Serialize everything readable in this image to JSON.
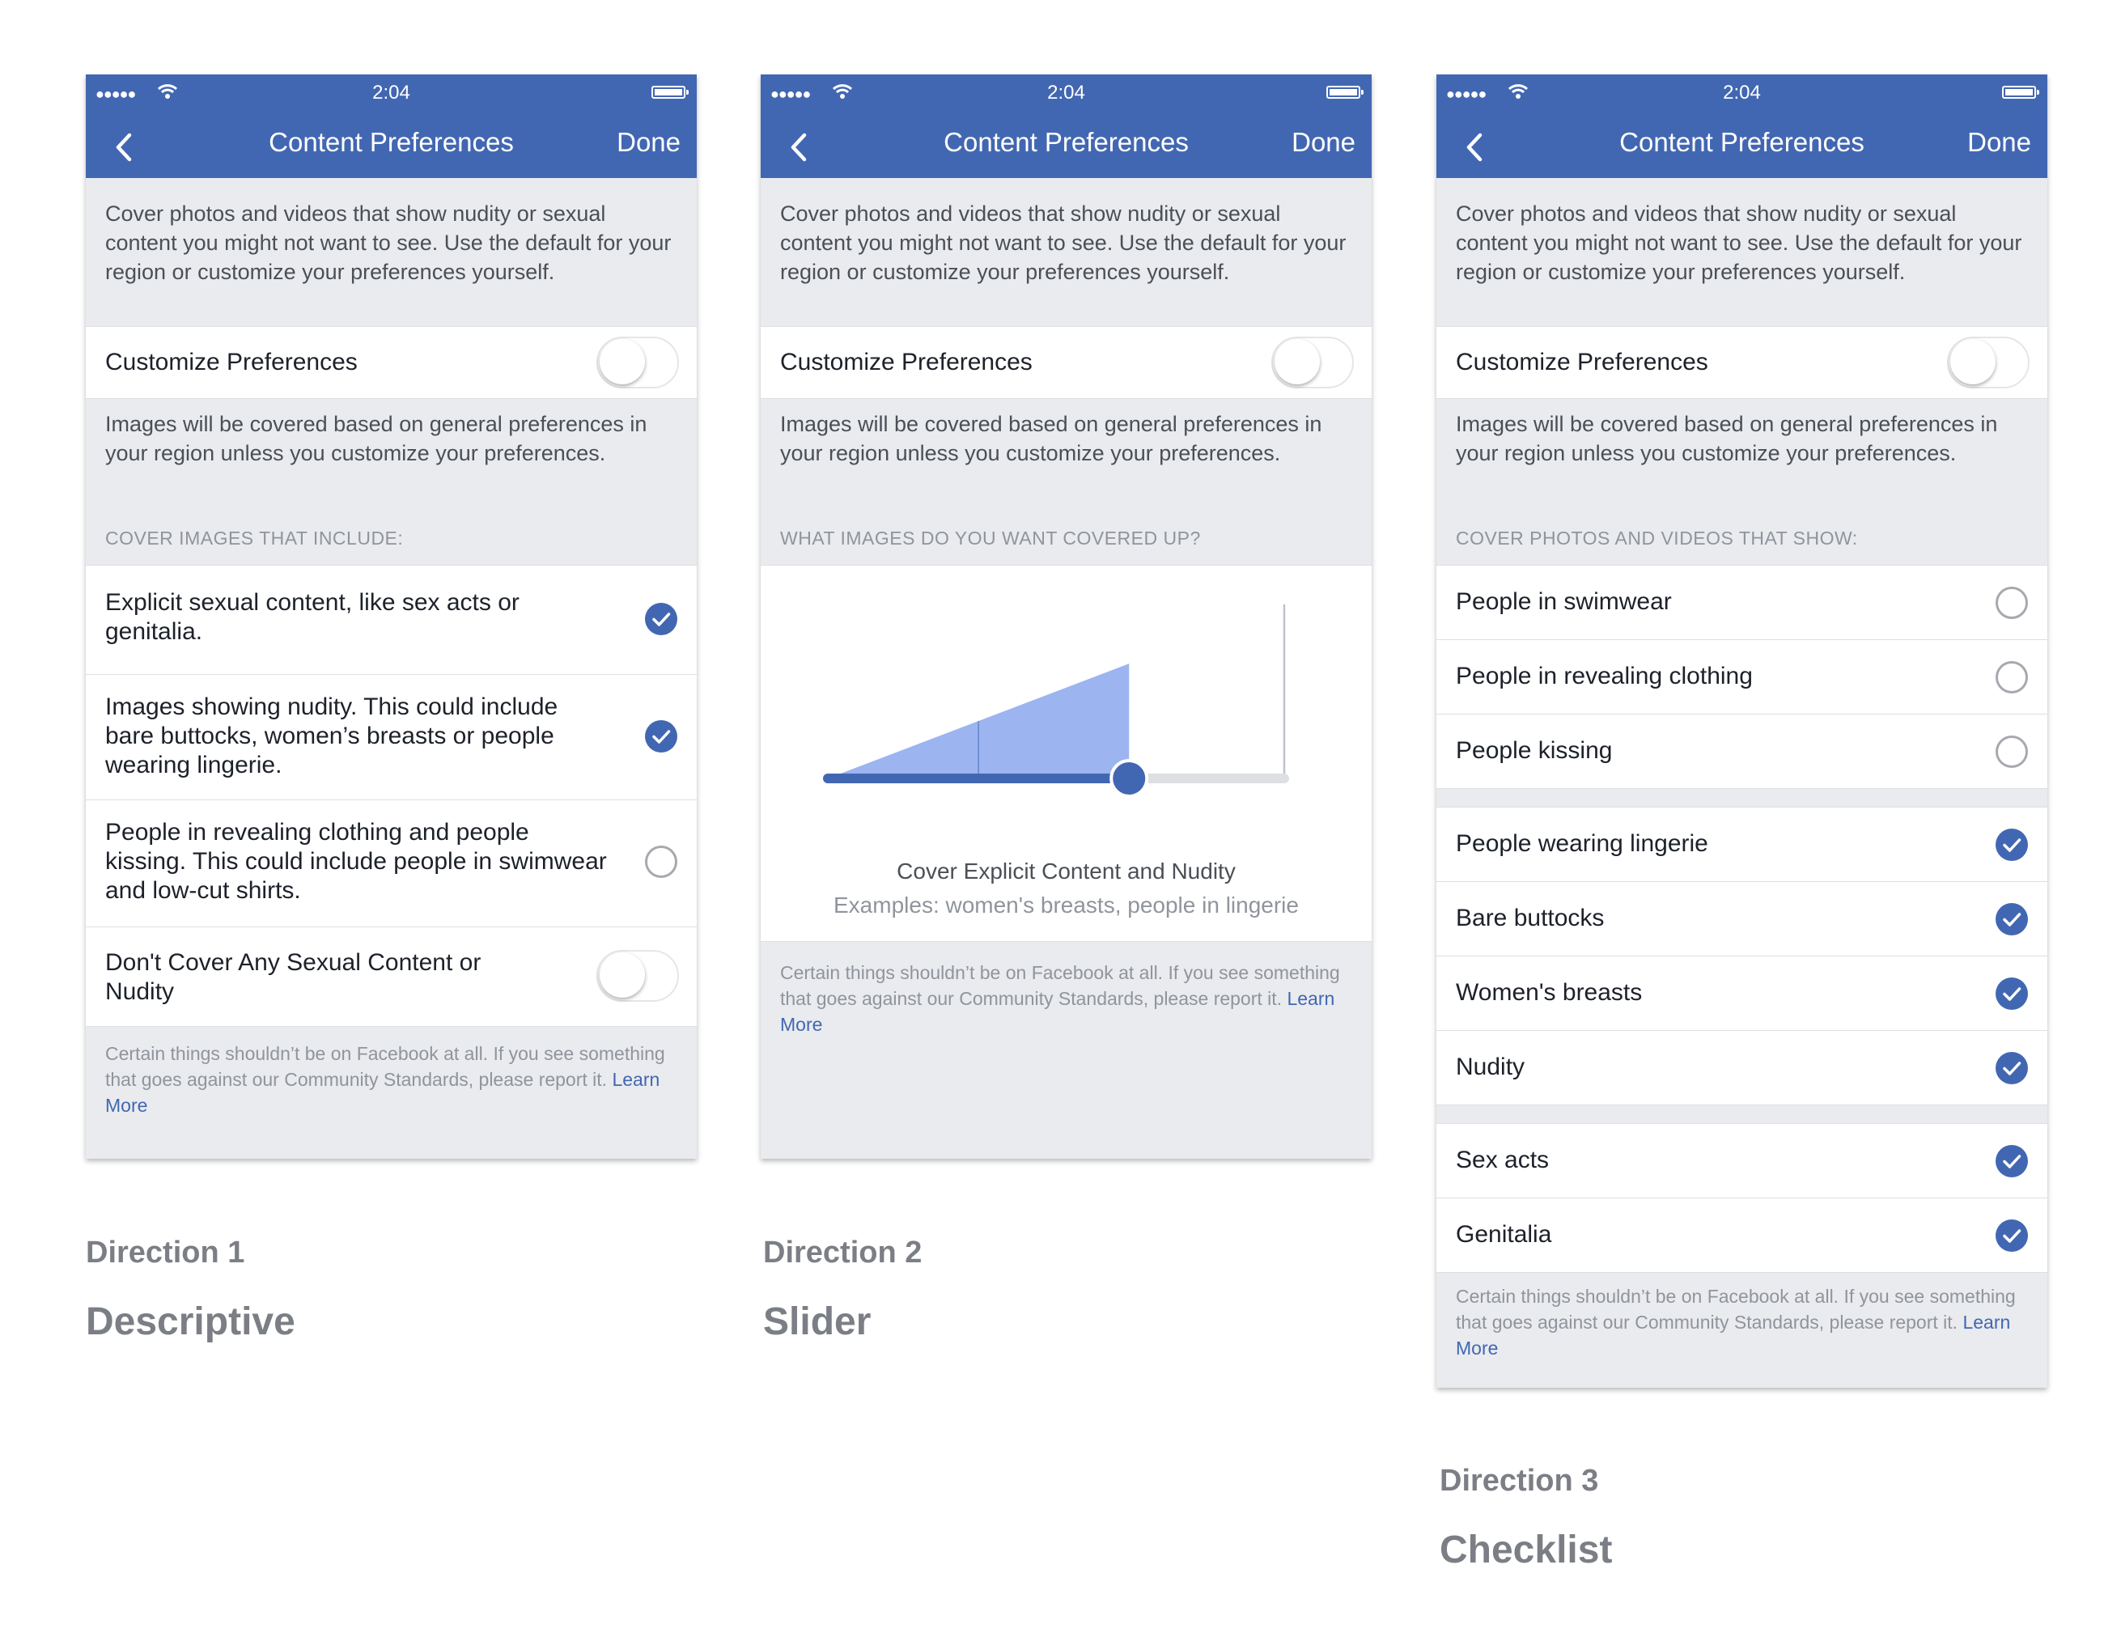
{
  "status_bar": {
    "signal": "●●●●●",
    "time": "2:04"
  },
  "nav": {
    "title": "Content Preferences",
    "done_label": "Done"
  },
  "intro_text": "Cover photos and videos that show nudity or sexual content you might not want to see. Use the default for your region or customize your preferences yourself.",
  "customize": {
    "label": "Customize Preferences",
    "on": false
  },
  "region_note": "Images will be covered based on general preferences in your region unless you customize your preferences.",
  "footer": {
    "text": "Certain things shouldn’t be on Facebook at all. If you see something that goes against our Community Standards, please report it.",
    "link": "Learn More"
  },
  "colors": {
    "brand": "#4267b2",
    "slider_fill": "#9cb4f0",
    "slider_track_off": "#dddfe2"
  },
  "directions": [
    {
      "label": "Direction 1",
      "name": "Descriptive",
      "section_header": "COVER IMAGES THAT INCLUDE:",
      "items": [
        {
          "text": "Explicit sexual content, like sex acts or genitalia.",
          "control": "check",
          "checked": true
        },
        {
          "text": "Images showing nudity. This could include bare buttocks, women’s breasts or people wearing lingerie.",
          "control": "check",
          "checked": true
        },
        {
          "text": "People in revealing clothing and people kissing. This could include people in swimwear and low-cut shirts.",
          "control": "radio",
          "checked": false
        },
        {
          "text": "Don't Cover Any Sexual Content or Nudity",
          "control": "toggle",
          "checked": false
        }
      ]
    },
    {
      "label": "Direction 2",
      "name": "Slider",
      "section_header": "WHAT IMAGES DO YOU WANT COVERED UP?",
      "slider": {
        "level": 0.66,
        "steps": 3,
        "caption": "Cover Explicit Content and Nudity",
        "examples": "Examples: women's breasts, people in lingerie"
      }
    },
    {
      "label": "Direction 3",
      "name": "Checklist",
      "section_header": "COVER PHOTOS AND VIDEOS THAT SHOW:",
      "groups": [
        [
          {
            "text": "People in swimwear",
            "checked": false
          },
          {
            "text": "People in revealing clothing",
            "checked": false
          },
          {
            "text": "People kissing",
            "checked": false
          }
        ],
        [
          {
            "text": "People wearing lingerie",
            "checked": true
          },
          {
            "text": "Bare buttocks",
            "checked": true
          },
          {
            "text": "Women's breasts",
            "checked": true
          },
          {
            "text": "Nudity",
            "checked": true
          }
        ],
        [
          {
            "text": "Sex acts",
            "checked": true
          },
          {
            "text": "Genitalia",
            "checked": true
          }
        ]
      ]
    }
  ]
}
